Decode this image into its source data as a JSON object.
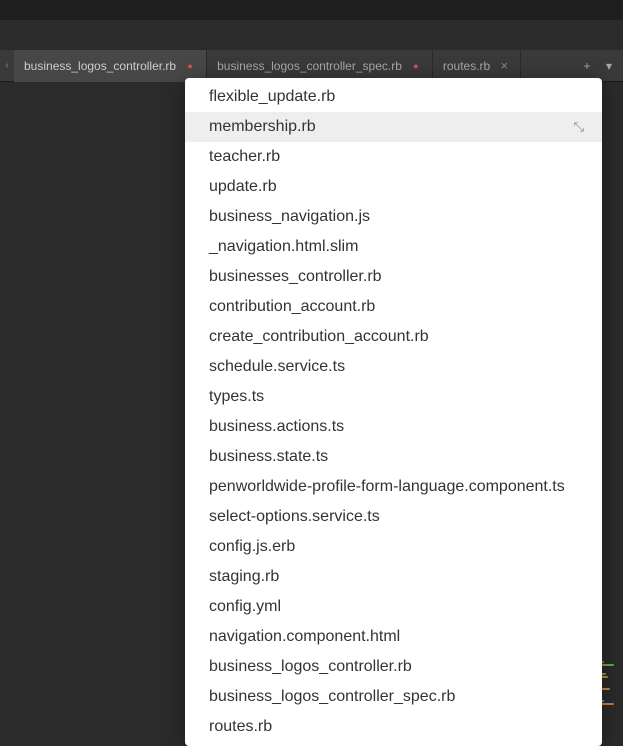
{
  "tabs": [
    {
      "label": "business_logos_controller.rb",
      "modified": true,
      "active": true
    },
    {
      "label": "business_logos_controller_spec.rb",
      "modified": true,
      "active": false
    },
    {
      "label": "routes.rb",
      "modified": false,
      "active": false
    }
  ],
  "dropdown": {
    "items": [
      {
        "label": "flexible_update.rb",
        "highlighted": false
      },
      {
        "label": "membership.rb",
        "highlighted": true,
        "pinned": true
      },
      {
        "label": "teacher.rb",
        "highlighted": false
      },
      {
        "label": "update.rb",
        "highlighted": false
      },
      {
        "label": "business_navigation.js",
        "highlighted": false
      },
      {
        "label": "_navigation.html.slim",
        "highlighted": false
      },
      {
        "label": "businesses_controller.rb",
        "highlighted": false
      },
      {
        "label": "contribution_account.rb",
        "highlighted": false
      },
      {
        "label": "create_contribution_account.rb",
        "highlighted": false
      },
      {
        "label": "schedule.service.ts",
        "highlighted": false
      },
      {
        "label": "types.ts",
        "highlighted": false
      },
      {
        "label": "business.actions.ts",
        "highlighted": false
      },
      {
        "label": "business.state.ts",
        "highlighted": false
      },
      {
        "label": "penworldwide-profile-form-language.component.ts",
        "highlighted": false
      },
      {
        "label": "select-options.service.ts",
        "highlighted": false
      },
      {
        "label": "config.js.erb",
        "highlighted": false
      },
      {
        "label": "staging.rb",
        "highlighted": false
      },
      {
        "label": "config.yml",
        "highlighted": false
      },
      {
        "label": "navigation.component.html",
        "highlighted": false
      },
      {
        "label": "business_logos_controller.rb",
        "highlighted": false
      },
      {
        "label": "business_logos_controller_spec.rb",
        "highlighted": false
      },
      {
        "label": "routes.rb",
        "highlighted": false
      }
    ]
  },
  "icons": {
    "scroll_left": "‹",
    "close": "×",
    "add": "+",
    "overflow": "▾",
    "pin": "⤡"
  },
  "minimap_colors": [
    "#c97f4a",
    "#6aa84f",
    "#cc8844",
    "#c97f4a",
    "#6aa84f",
    "#a05e3b",
    "#c97f4a",
    "#6aa84f",
    "#cc8844",
    "#a05e3b",
    "#c97f4a",
    "#6aa84f",
    "#cc8844",
    "#c97f4a",
    "#a05e3b",
    "#6aa84f",
    "#cc8844",
    "#c97f4a",
    "#6aa84f",
    "#a05e3b"
  ]
}
